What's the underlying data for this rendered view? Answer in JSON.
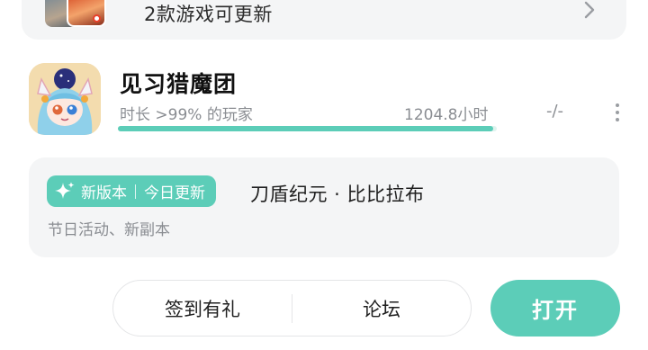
{
  "update_banner": {
    "text": "2款游戏可更新",
    "chevron_icon": "chevron-right-icon"
  },
  "game": {
    "title": "见习猎魔团",
    "play_meta": "时长 >99% 的玩家",
    "play_hours": "1204.8小时",
    "progress_fraction": 0.99,
    "rating": "-/-",
    "more_icon": "more-vertical-icon"
  },
  "update_card": {
    "badge_icon": "sparkle-icon",
    "badge_left": "新版本",
    "badge_right": "今日更新",
    "title": "刀盾纪元 · 比比拉布",
    "description": "节日活动、新副本"
  },
  "actions": {
    "signin_label": "签到有礼",
    "forum_label": "论坛",
    "open_label": "打开"
  },
  "colors": {
    "accent": "#5ccdb8",
    "card_bg": "#f4f5f6",
    "muted_text": "#8a8d92"
  }
}
